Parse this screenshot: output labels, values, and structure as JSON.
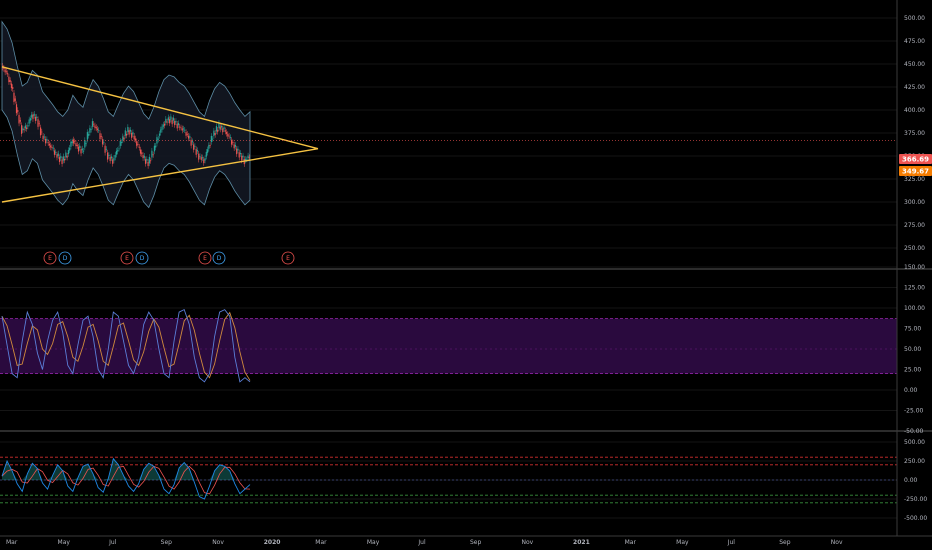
{
  "colors": {
    "background": "#000000",
    "grid": "#2a2a2a",
    "axis_text": "#b2b5be",
    "candle_up": "#26a69a",
    "candle_down": "#ef5350",
    "trendline": "#f5c242",
    "band_fill": "#131722",
    "band_border": "#5d8da6",
    "stoch_k": "#5b7fd8",
    "stoch_d": "#d08a3d",
    "stoch_band": "#2a0a3e",
    "stoch_band_line": "#9c27b0",
    "cci": "#1e88e5",
    "cci_signal": "#ef5350",
    "cci_up_fill": "#26a69a",
    "level_red": "#d32f2f",
    "level_green": "#388e3c",
    "price_tag_1": "#ef5350",
    "price_tag_2": "#f57c00",
    "earnings": "#ef5350",
    "dividends": "#42a5f5"
  },
  "price_axis": {
    "labels": [
      "500.00",
      "475.00",
      "450.00",
      "425.00",
      "400.00",
      "375.00",
      "350.00",
      "325.00",
      "300.00",
      "275.00",
      "250.00"
    ],
    "values": [
      500,
      475,
      450,
      425,
      400,
      375,
      350,
      325,
      300,
      275,
      250
    ]
  },
  "price_tags": [
    {
      "label": "366.69",
      "value": 366.69,
      "color_key": "price_tag_1"
    },
    {
      "label": "349.67",
      "value": 349.67,
      "color_key": "price_tag_2"
    }
  ],
  "stoch_axis": {
    "labels": [
      "150.00",
      "125.00",
      "100.00",
      "75.00",
      "50.00",
      "25.00",
      "0.00",
      "-25.00",
      "-50.00"
    ],
    "values": [
      150,
      125,
      100,
      75,
      50,
      25,
      0,
      -25,
      -50
    ]
  },
  "cci_axis": {
    "labels": [
      "500.00",
      "250.00",
      "0.00",
      "-250.00",
      "-500.00"
    ],
    "values": [
      500,
      250,
      0,
      -250,
      -500
    ]
  },
  "time_axis": {
    "labels": [
      "Mar",
      "May",
      "Jul",
      "Sep",
      "Nov",
      "2020",
      "Mar",
      "May",
      "Jul",
      "Sep",
      "Nov",
      "2021",
      "Mar",
      "May",
      "Jul",
      "Sep",
      "Nov"
    ],
    "bold": [
      false,
      false,
      false,
      false,
      false,
      true,
      false,
      false,
      false,
      false,
      false,
      true,
      false,
      false,
      false,
      false,
      false
    ]
  },
  "events": [
    {
      "letter": "E",
      "type": "earnings"
    },
    {
      "letter": "D",
      "type": "dividends"
    },
    {
      "letter": "E",
      "type": "earnings"
    },
    {
      "letter": "D",
      "type": "dividends"
    },
    {
      "letter": "E",
      "type": "earnings"
    },
    {
      "letter": "D",
      "type": "dividends"
    },
    {
      "letter": "E",
      "type": "earnings"
    }
  ],
  "chart_data": {
    "type": "candlestick",
    "price_close_path": [
      448,
      440,
      425,
      400,
      378,
      382,
      395,
      390,
      372,
      365,
      358,
      350,
      345,
      352,
      368,
      360,
      355,
      372,
      385,
      378,
      365,
      350,
      345,
      358,
      370,
      378,
      372,
      360,
      348,
      342,
      355,
      372,
      385,
      390,
      388,
      382,
      378,
      370,
      360,
      350,
      345,
      362,
      375,
      382,
      378,
      370,
      360,
      352,
      345,
      350
    ],
    "trendline_upper": {
      "start": [
        0,
        447
      ],
      "end": [
        61,
        358
      ]
    },
    "trendline_lower": {
      "start": [
        0,
        300
      ],
      "end": [
        61,
        358
      ]
    },
    "stoch_k": [
      90,
      55,
      20,
      15,
      60,
      95,
      80,
      45,
      25,
      60,
      85,
      95,
      70,
      30,
      20,
      55,
      85,
      90,
      65,
      25,
      15,
      50,
      95,
      90,
      60,
      30,
      20,
      40,
      80,
      95,
      85,
      50,
      20,
      15,
      60,
      95,
      98,
      80,
      40,
      15,
      10,
      20,
      65,
      95,
      98,
      90,
      40,
      10,
      15,
      10
    ],
    "stoch_band": [
      20,
      80
    ],
    "cci_levels": {
      "red": [
        300,
        200
      ],
      "green": [
        -200,
        -300
      ]
    },
    "cci": [
      50,
      250,
      120,
      -50,
      -150,
      80,
      220,
      150,
      -40,
      -120,
      60,
      200,
      120,
      -80,
      -150,
      30,
      180,
      210,
      80,
      -100,
      -160,
      20,
      280,
      200,
      60,
      -80,
      -150,
      -50,
      140,
      220,
      180,
      60,
      -120,
      -180,
      -60,
      160,
      230,
      150,
      -30,
      -220,
      -250,
      -80,
      120,
      200,
      180,
      120,
      -50,
      -180,
      -120,
      -60
    ]
  }
}
